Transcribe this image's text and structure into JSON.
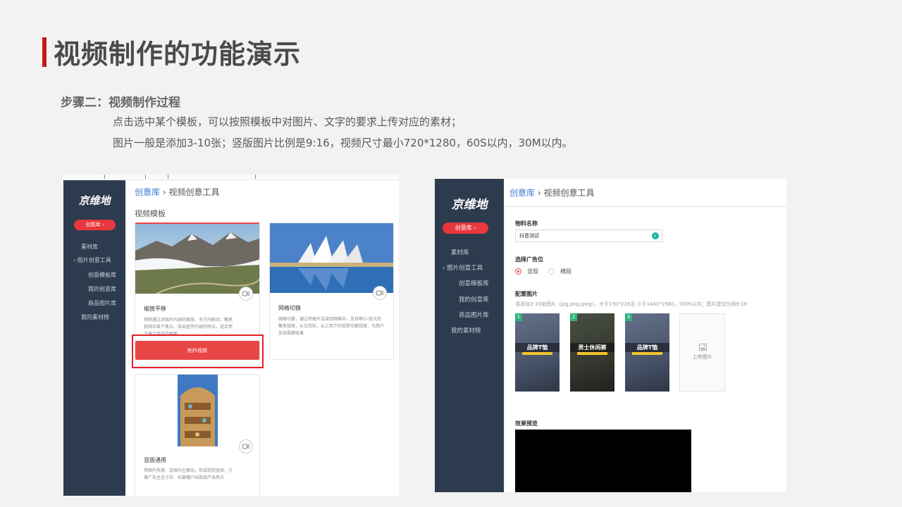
{
  "slide": {
    "title": "视频制作的功能演示",
    "step": "步骤二：视频制作过程",
    "desc1": "点击选中某个模板，可以按照模板中对图片、文字的要求上传对应的素材；",
    "desc2": "图片一般是添加3-10张；竖版图片比例是9:16，视频尺寸最小720*1280，60S以内，30M以内。"
  },
  "left": {
    "logo": "京维地",
    "pill": "创意库 ›",
    "nav": [
      "素材库",
      "› 图片创意工具",
      "创意模板库",
      "我的创意库",
      "商品图片库",
      "我的素材榜"
    ],
    "crumb_link": "创意库",
    "crumb_rest": " › 视频创意工具",
    "section": "视频模板",
    "cards": [
      {
        "title": "缩放平移",
        "desc": "视频通过对图片内容的缩放、多方向移动，聚焦视频中某个焦点，突出宣传内容的特点，适合用于展示商品的画面"
      },
      {
        "title": "网格切换",
        "desc": "网格切换，通过将图片渲染到网格中，支持缩小-放大的聚焦规律，从左到右，从上到下的视觉切换规律，为用户呈现震撼效果"
      },
      {
        "title": "竖版通用",
        "desc": "将图片快速、连续向左推动，形成视觉连续，方便广告主全方位、长篇幅介绍商品产品亮点"
      }
    ],
    "make_button": "制作视频"
  },
  "right": {
    "logo": "京维地",
    "pill": "创意库 ›",
    "nav": [
      "素材库",
      "› 图片创意工具",
      "创意模板库",
      "我的创意库",
      "商品图片库",
      "我的素材榜"
    ],
    "crumb_link": "创意库",
    "crumb_rest": " › 视频创意工具",
    "material_label": "物料名称",
    "material_value": "抖音测试",
    "ad_label": "选择广告位",
    "ad_options": [
      "竖版",
      "横版"
    ],
    "image_label": "配置图片",
    "hint": "请添加3-10张图片（jpg,png,jpeg）。大于150*228且 小于1440*2560，500K以内；图片建议比例9:16",
    "images": [
      {
        "num": "1",
        "brand": "品牌T恤"
      },
      {
        "num": "2",
        "brand": "男士休闲裤"
      },
      {
        "num": "3",
        "brand": "品牌T恤"
      }
    ],
    "upload_label": "上传图片",
    "preview_label": "效果预览"
  }
}
